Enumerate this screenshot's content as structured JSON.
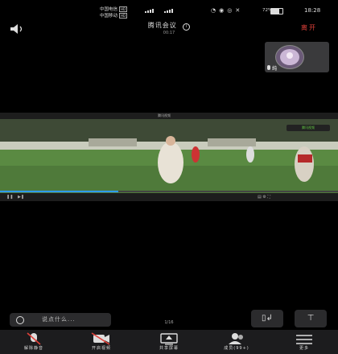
{
  "status_bar": {
    "carrier1": "中国电信",
    "carrier2": "中国移动",
    "hd": "HD",
    "battery": "72%",
    "battery_level": 0.72,
    "time": "18:28"
  },
  "header": {
    "title": "腾讯会议",
    "subtitle": "00:17",
    "leave_label": "离开"
  },
  "participant": {
    "name": "纯"
  },
  "screen": {
    "top_title": "腾讯视频",
    "logo_text": "腾讯视频",
    "page": "1/16",
    "progress": 0.35
  },
  "chat": {
    "placeholder": "说点什么..."
  },
  "toolbar": [
    {
      "label": "解除静音",
      "icon": "muted-mic-icon"
    },
    {
      "label": "开启视频",
      "icon": "video-off-icon"
    },
    {
      "label": "共享屏幕",
      "icon": "share-screen-icon"
    },
    {
      "label": "成员(99+)",
      "icon": "members-icon"
    },
    {
      "label": "更多",
      "icon": "more-icon"
    }
  ],
  "colors": {
    "leave": "#e0413a",
    "accent": "#2f9bff",
    "muted": "#e0413a"
  }
}
